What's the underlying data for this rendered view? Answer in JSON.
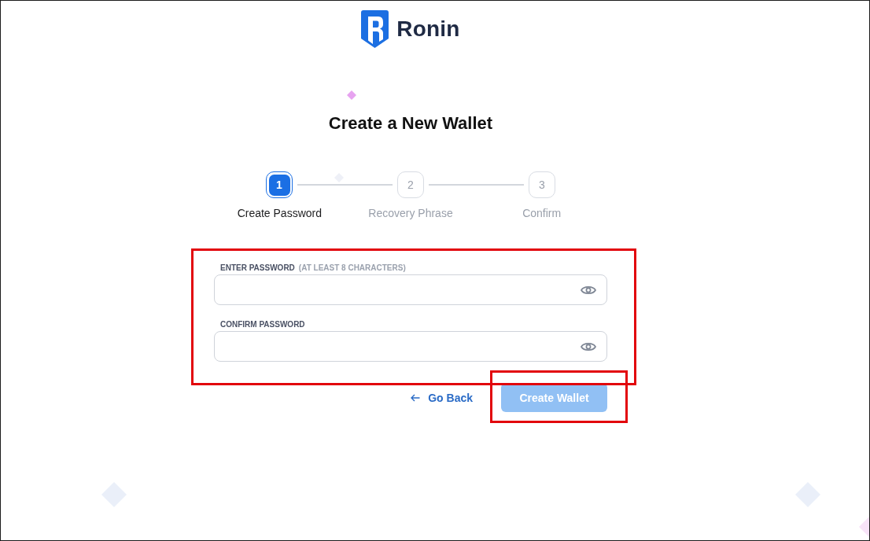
{
  "logo": {
    "name": "Ronin"
  },
  "title": "Create a New Wallet",
  "steps": [
    {
      "number": "1",
      "label": "Create Password",
      "selected": true
    },
    {
      "number": "2",
      "label": "Recovery Phrase",
      "selected": false
    },
    {
      "number": "3",
      "label": "Confirm",
      "selected": false
    }
  ],
  "fields": [
    {
      "label": "ENTER PASSWORD",
      "hint": "(AT LEAST 8 CHARACTERS)"
    },
    {
      "label": "CONFIRM PASSWORD"
    }
  ],
  "actions": {
    "back": "Go Back",
    "submit": {
      "label": "Create Wallet",
      "disabled": true
    }
  }
}
